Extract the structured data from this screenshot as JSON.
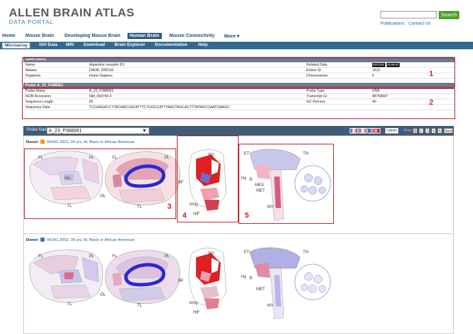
{
  "header": {
    "title": "ALLEN BRAIN ATLAS",
    "subtitle": "DATA PORTAL",
    "search_button": "Search",
    "links": [
      "Publications",
      "Contact Us"
    ]
  },
  "nav_primary": [
    "Home",
    "Mouse Brain",
    "Developing Mouse Brain",
    "Human Brain",
    "Mouse Connectivity",
    "More"
  ],
  "nav_primary_active": "Human Brain",
  "nav_secondary": [
    "Microarray",
    "ISH Data",
    "MRI",
    "Download",
    "Brain Explorer",
    "Documentation",
    "Help"
  ],
  "nav_secondary_active": "Microarray",
  "gene_panel": {
    "title": "Gene DRD1",
    "rows": [
      {
        "label": "Name",
        "value": "dopamine receptor D1",
        "label2": "Related Data",
        "value2": ""
      },
      {
        "label": "Aliases",
        "value": "DADR, DRD1A",
        "label2": "Entrez ID",
        "value2": "1812"
      },
      {
        "label": "Organism",
        "value": "Homo Sapiens",
        "label2": "Chromosome",
        "value2": "5"
      }
    ],
    "related_badges": [
      "MOUSE",
      "HUMAN"
    ]
  },
  "probe_panel": {
    "title": "Probe A_23_P388061",
    "rows": [
      {
        "label": "Probe Name",
        "value": "A_23_P388061",
        "label2": "Probe Type",
        "value2": "DNA"
      },
      {
        "label": "NCBI Accession",
        "value": "NM_000794.3",
        "label2": "Transcript GI",
        "value2": "88758587"
      },
      {
        "label": "Sequence Length",
        "value": "60",
        "label2": "GC Percent",
        "value2": "40"
      },
      {
        "label": "Sequence Data",
        "value": "TCCAAGACCTTACAACCACATTTCTGGCCATTTAACTAGCACTTTATAGCCAATGAAGC",
        "label2": "",
        "value2": ""
      }
    ]
  },
  "annotations": [
    "1",
    "2",
    "3",
    "4",
    "5"
  ],
  "probe_bar": {
    "label": "Probe Name:",
    "selected": "A_23_P388061",
    "labels_button": "Labels",
    "prev": "Prev",
    "pages": [
      "1",
      "2",
      "3",
      "4",
      "5"
    ],
    "next": "Next"
  },
  "donors": [
    {
      "text": "H0351.2001, 24 yrs, M, Black or African American",
      "color": "#e8961e"
    },
    {
      "text": "H0351.2002, 39 yrs, M, Black or African American",
      "color": "#3a78b8"
    }
  ],
  "region_labels": {
    "fl": "FL",
    "pl": "PL",
    "ins": "Ins",
    "tl": "TL",
    "ol": "OL",
    "bg": "BG",
    "bf": "BF",
    "amg": "Amg",
    "hif": "HiF",
    "et": "ET",
    "th": "TH",
    "hy": "Hy",
    "b": "B",
    "mes": "MES",
    "met": "MET",
    "my": "MY"
  },
  "colors": {
    "accent": "#326992",
    "annotation_red": "#c41e26",
    "search_green": "#4da02b"
  }
}
